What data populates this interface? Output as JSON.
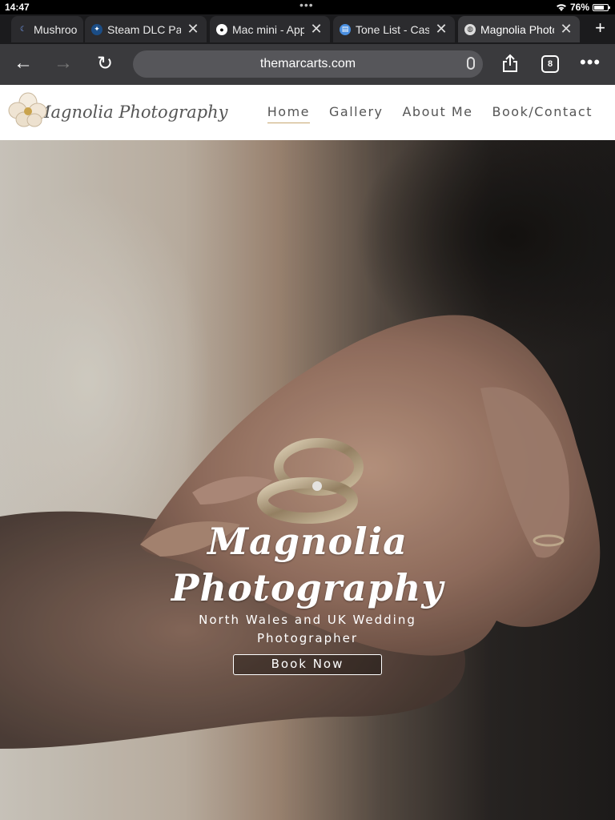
{
  "status": {
    "time": "14:47",
    "battery": "76%"
  },
  "tabs": [
    {
      "title": "Mushrooms",
      "favicon": "moon-icon",
      "active": false
    },
    {
      "title": "Steam DLC Page",
      "favicon": "steam-icon",
      "active": false
    },
    {
      "title": "Mac mini - Apple",
      "favicon": "apple-icon",
      "active": false
    },
    {
      "title": "Tone List - Castle",
      "favicon": "book-icon",
      "active": false
    },
    {
      "title": "Magnolia Photography",
      "favicon": "globe-icon",
      "active": true
    }
  ],
  "toolbar": {
    "url": "themarcarts.com",
    "tab_count": "8"
  },
  "site": {
    "logo_text": "Magnolia Photography",
    "nav": [
      {
        "label": "Home",
        "active": true
      },
      {
        "label": "Gallery",
        "active": false
      },
      {
        "label": "About Me",
        "active": false
      },
      {
        "label": "Book/Contact",
        "active": false
      }
    ]
  },
  "hero": {
    "title_line1": "Magnolia",
    "title_line2": "Photography",
    "subtitle_line1": "North Wales and UK Wedding",
    "subtitle_line2": "Photographer",
    "cta": "Book Now"
  },
  "colors": {
    "accent": "#c7a76f",
    "chrome_dark": "#3a3a3d",
    "tab_bg": "#2b2b2e"
  }
}
